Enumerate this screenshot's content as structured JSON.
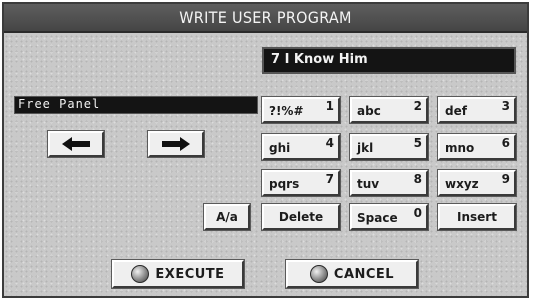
{
  "dialog": {
    "title": "WRITE USER PROGRAM"
  },
  "song_display": "7 I Know Him",
  "name_field": {
    "value": "Free Panel"
  },
  "keypad": [
    {
      "label": "?!%#",
      "num": "1"
    },
    {
      "label": "abc",
      "num": "2"
    },
    {
      "label": "def",
      "num": "3"
    },
    {
      "label": "ghi",
      "num": "4"
    },
    {
      "label": "jkl",
      "num": "5"
    },
    {
      "label": "mno",
      "num": "6"
    },
    {
      "label": "pqrs",
      "num": "7"
    },
    {
      "label": "tuv",
      "num": "8"
    },
    {
      "label": "wxyz",
      "num": "9"
    }
  ],
  "buttons": {
    "case": "A/a",
    "delete": "Delete",
    "space": "Space",
    "space_num": "0",
    "insert": "Insert",
    "execute": "EXECUTE",
    "cancel": "CANCEL"
  },
  "icons": {
    "left": "arrow-left-icon",
    "right": "arrow-right-icon",
    "led": "led-indicator-icon"
  }
}
